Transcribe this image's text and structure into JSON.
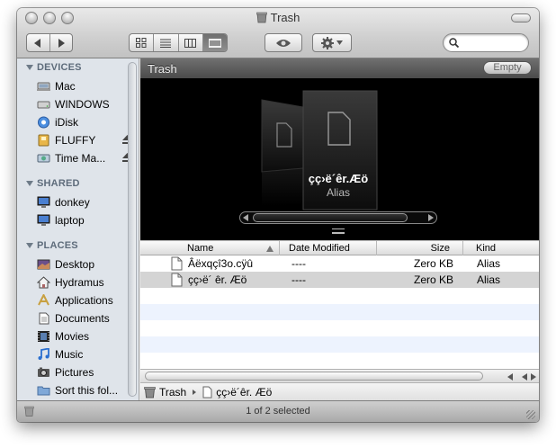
{
  "window": {
    "title": "Trash"
  },
  "toolbar": {
    "search_placeholder": "",
    "view_modes": [
      "icon-view",
      "list-view",
      "column-view",
      "cover-flow-view"
    ],
    "selected_view": "cover-flow-view"
  },
  "sidebar": {
    "sections": [
      {
        "label": "DEVICES",
        "items": [
          {
            "label": "Mac",
            "icon": "computer-icon"
          },
          {
            "label": "WINDOWS",
            "icon": "drive-icon"
          },
          {
            "label": "iDisk",
            "icon": "idisk-icon"
          },
          {
            "label": "FLUFFY",
            "icon": "usb-drive-icon",
            "eject": true
          },
          {
            "label": "Time Ma...",
            "icon": "time-machine-icon",
            "eject": true
          }
        ]
      },
      {
        "label": "SHARED",
        "items": [
          {
            "label": "donkey",
            "icon": "network-computer-icon"
          },
          {
            "label": "laptop",
            "icon": "network-computer-icon"
          }
        ]
      },
      {
        "label": "PLACES",
        "items": [
          {
            "label": "Desktop",
            "icon": "desktop-icon"
          },
          {
            "label": "Hydramus",
            "icon": "home-icon"
          },
          {
            "label": "Applications",
            "icon": "applications-icon"
          },
          {
            "label": "Documents",
            "icon": "documents-icon"
          },
          {
            "label": "Movies",
            "icon": "movies-icon"
          },
          {
            "label": "Music",
            "icon": "music-icon"
          },
          {
            "label": "Pictures",
            "icon": "pictures-icon"
          },
          {
            "label": "Sort this fol...",
            "icon": "folder-icon"
          }
        ]
      }
    ]
  },
  "main": {
    "header_title": "Trash",
    "empty_button": "Empty",
    "coverflow": {
      "selected_name": "çç›ë´êr.Æö",
      "selected_kind": "Alias"
    },
    "columns": {
      "name": "Name",
      "date": "Date Modified",
      "size": "Size",
      "kind": "Kind"
    },
    "rows": [
      {
        "name": "Âëxqçî3o.cÿû",
        "date": "----",
        "size": "Zero KB",
        "kind": "Alias",
        "selected": false
      },
      {
        "name": "çç›ë´ êr. Æö",
        "date": "----",
        "size": "Zero KB",
        "kind": "Alias",
        "selected": true
      }
    ],
    "path": {
      "root": "Trash",
      "item": "çç›ë´êr. Æö"
    }
  },
  "status": {
    "text": "1 of 2 selected"
  },
  "colors": {
    "selected_row": "#d4d4d4",
    "stripe": "#edf3fe",
    "sidebar_bg": "#dfe4ea"
  }
}
